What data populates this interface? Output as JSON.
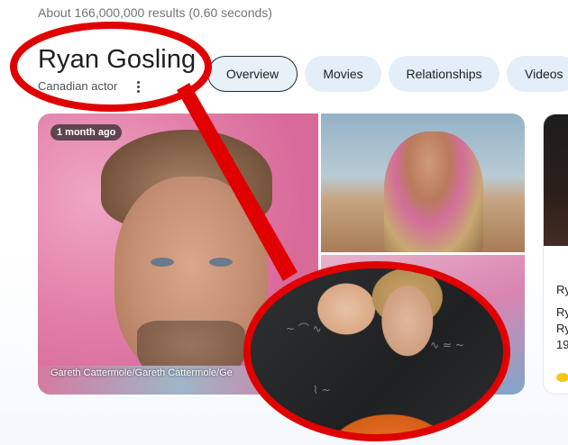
{
  "search": {
    "results_summary": "About 166,000,000 results (0.60 seconds)"
  },
  "entity": {
    "title": "Ryan Gosling",
    "subtitle": "Canadian actor"
  },
  "tabs": [
    {
      "label": "Overview",
      "active": true
    },
    {
      "label": "Movies",
      "active": false
    },
    {
      "label": "Relationships",
      "active": false
    },
    {
      "label": "Videos",
      "active": false
    }
  ],
  "images": {
    "main": {
      "badge": "1 month ago",
      "credit": "Gareth Cattermole/Gareth Cattermole/Ge"
    }
  },
  "side_card": {
    "lines": [
      "Ry",
      "Ry",
      "Ry",
      "19"
    ]
  },
  "colors": {
    "highlight": "#e00000",
    "chip_bg": "#e3eef9"
  }
}
